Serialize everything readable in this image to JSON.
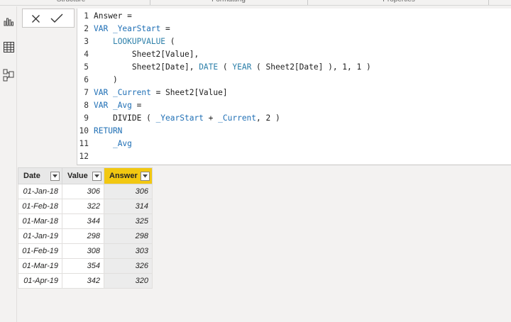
{
  "ribbon": {
    "groups": [
      "Structure",
      "Formatting",
      "Properties"
    ]
  },
  "left_rail": {
    "icons": [
      "report-view-icon",
      "data-view-icon",
      "model-view-icon"
    ]
  },
  "commit": {
    "cancel_icon": "close-icon",
    "confirm_icon": "check-icon"
  },
  "formula": {
    "lines": [
      {
        "n": "1",
        "segments": [
          {
            "t": "Answer =",
            "c": "plain"
          }
        ]
      },
      {
        "n": "2",
        "segments": [
          {
            "t": "VAR ",
            "c": "kw"
          },
          {
            "t": "_YearStart",
            "c": "var"
          },
          {
            "t": " =",
            "c": "plain"
          }
        ]
      },
      {
        "n": "3",
        "segments": [
          {
            "t": "    ",
            "c": "plain"
          },
          {
            "t": "LOOKUPVALUE",
            "c": "fn"
          },
          {
            "t": " (",
            "c": "plain"
          }
        ]
      },
      {
        "n": "4",
        "segments": [
          {
            "t": "        Sheet2[Value],",
            "c": "plain"
          }
        ]
      },
      {
        "n": "5",
        "segments": [
          {
            "t": "        Sheet2[Date], ",
            "c": "plain"
          },
          {
            "t": "DATE",
            "c": "fn"
          },
          {
            "t": " ( ",
            "c": "plain"
          },
          {
            "t": "YEAR",
            "c": "fn"
          },
          {
            "t": " ( Sheet2[Date] ), 1, 1 )",
            "c": "plain"
          }
        ]
      },
      {
        "n": "6",
        "segments": [
          {
            "t": "    )",
            "c": "plain"
          }
        ]
      },
      {
        "n": "7",
        "segments": [
          {
            "t": "VAR ",
            "c": "kw"
          },
          {
            "t": "_Current",
            "c": "var"
          },
          {
            "t": " = Sheet2[Value]",
            "c": "plain"
          }
        ]
      },
      {
        "n": "8",
        "segments": [
          {
            "t": "VAR ",
            "c": "kw"
          },
          {
            "t": "_Avg",
            "c": "var"
          },
          {
            "t": " =",
            "c": "plain"
          }
        ]
      },
      {
        "n": "9",
        "segments": [
          {
            "t": "    DIVIDE ( ",
            "c": "plain"
          },
          {
            "t": "_YearStart",
            "c": "var"
          },
          {
            "t": " + ",
            "c": "plain"
          },
          {
            "t": "_Current",
            "c": "var"
          },
          {
            "t": ", 2 )",
            "c": "plain"
          }
        ]
      },
      {
        "n": "10",
        "segments": [
          {
            "t": "RETURN",
            "c": "kw"
          }
        ]
      },
      {
        "n": "11",
        "segments": [
          {
            "t": "    ",
            "c": "plain"
          },
          {
            "t": "_Avg",
            "c": "var"
          }
        ]
      },
      {
        "n": "12",
        "segments": []
      }
    ]
  },
  "table": {
    "columns": [
      "Date",
      "Value",
      "Answer"
    ],
    "selected_column": "Answer",
    "rows": [
      [
        "01-Jan-18",
        "306",
        "306"
      ],
      [
        "01-Feb-18",
        "322",
        "314"
      ],
      [
        "01-Mar-18",
        "344",
        "325"
      ],
      [
        "01-Jan-19",
        "298",
        "298"
      ],
      [
        "01-Feb-19",
        "308",
        "303"
      ],
      [
        "01-Mar-19",
        "354",
        "326"
      ],
      [
        "01-Apr-19",
        "342",
        "320"
      ]
    ]
  },
  "colors": {
    "selected_header": "#f2c811",
    "keyword": "#1f6fb5"
  }
}
